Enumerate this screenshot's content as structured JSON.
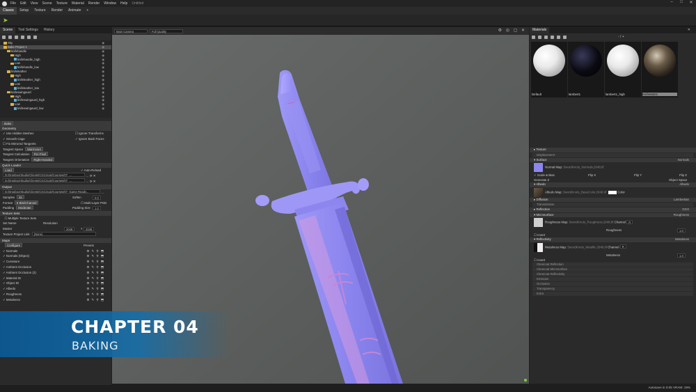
{
  "app": {
    "menu": [
      "File",
      "Edit",
      "View",
      "Scene",
      "Texture",
      "Material",
      "Render",
      "Window",
      "Help"
    ],
    "document_title": "Untitled"
  },
  "modes": [
    "Classic",
    "Setup",
    "Texture",
    "Render",
    "Animate",
    "+"
  ],
  "left_tabs": [
    "Scene",
    "Tool Settings",
    "History"
  ],
  "tree": [
    {
      "label": "Sky",
      "indent": 1,
      "type": "folder"
    },
    {
      "label": "Bake Project 1",
      "indent": 1,
      "type": "folder",
      "selected": true
    },
    {
      "label": "knifehandle",
      "indent": 2,
      "type": "folder"
    },
    {
      "label": "High",
      "indent": 3,
      "type": "folder"
    },
    {
      "label": "knifehandle_high",
      "indent": 4,
      "type": "mesh"
    },
    {
      "label": "Low",
      "indent": 3,
      "type": "folder"
    },
    {
      "label": "knifehandle_low",
      "indent": 4,
      "type": "mesh"
    },
    {
      "label": "knifeleather",
      "indent": 2,
      "type": "folder"
    },
    {
      "label": "High",
      "indent": 3,
      "type": "folder"
    },
    {
      "label": "knifeleather_high",
      "indent": 4,
      "type": "mesh"
    },
    {
      "label": "Low",
      "indent": 3,
      "type": "folder"
    },
    {
      "label": "knifeleather_low",
      "indent": 4,
      "type": "mesh"
    },
    {
      "label": "knifeswingaurd",
      "indent": 2,
      "type": "folder"
    },
    {
      "label": "High",
      "indent": 3,
      "type": "folder"
    },
    {
      "label": "knifeswingaurd_high",
      "indent": 4,
      "type": "mesh"
    },
    {
      "label": "Low",
      "indent": 3,
      "type": "folder"
    },
    {
      "label": "knifeswingaurd_low",
      "indent": 4,
      "type": "mesh"
    }
  ],
  "bake": {
    "button": "Bake",
    "geometry_header": "Geometry",
    "use_hidden": "Use Hidden Meshes",
    "ignore_transforms": "Ignore Transforms",
    "smooth_cage": "Smooth Cage",
    "ignore_back_faces": "Ignore Back Faces",
    "fix_mirrored": "Fix Mirrored Tangents",
    "tangent_space_label": "Tangent Space",
    "tangent_space": "Marmoset",
    "tangent_calc_label": "Tangent Calculation",
    "tangent_calc": "Per-Pixel",
    "tangent_orient_label": "Tangent Orientation",
    "tangent_orient": "Right-Handed",
    "quick_loader": "Quick Loader",
    "load": "Load",
    "auto_reload": "Auto-Reload",
    "path1": "D:/Dropbox/Studio/Clients/CGCircuit/Courses/07_...",
    "path2": "D:/Dropbox/Studio/Clients/CGCircuit/Courses/07_...",
    "output_header": "Output",
    "output_path": "D:/Dropbox/Studio/Clients/CGCircuit/Courses/07_Game Ready...",
    "samples_label": "Samples",
    "samples": "4x",
    "soften_label": "Soften",
    "soften": "0.0",
    "format_label": "Format",
    "format": "8 Bits/Channel",
    "multi_layer": "Multi-Layer PSD",
    "padding_label": "Padding",
    "padding": "Moderate",
    "padding_size_label": "Padding Size",
    "padding_size": "1.0",
    "texture_sets": "Texture Sets",
    "multiple_sets": "Multiple Texture Sets",
    "set_name": "Set Name",
    "resolution": "Resolution",
    "master": "Master",
    "res_w": "2048",
    "res_h": "2048",
    "project_link_label": "Texture Project Link",
    "project_link": "(None)",
    "maps_header": "Maps",
    "configure": "Configure",
    "presets": "Presets",
    "maps": [
      "Normals",
      "Normals (Object)",
      "Curvature",
      "Ambient Occlusion",
      "Ambient Occlusion (2)",
      "Material ID",
      "Object ID",
      "Albedo",
      "Roughness",
      "Metalness"
    ]
  },
  "viewport": {
    "camera": "Main Camera",
    "quality": "Full Quality"
  },
  "materials": {
    "title": "Materials",
    "count": "- / +",
    "items": [
      {
        "name": "Default",
        "style": "white"
      },
      {
        "name": "lambert1",
        "style": "dark"
      },
      {
        "name": "lambert1_high",
        "style": "white"
      },
      {
        "name": "KnifeMat01",
        "style": "metal",
        "selected": true
      }
    ],
    "sections": {
      "texture": "Texture",
      "displacement": "Displacement",
      "surface": "Surface",
      "surface_val": "Normals",
      "normal_map": "Normal Map:",
      "normal_file": "SwordKnots_Normals.2048.tif",
      "scale_bias": "Scale & Bias",
      "flip_x": "Flip X",
      "flip_y": "Flip Y",
      "flip_z": "Flip Z",
      "generate_z": "Generate Z",
      "object_space": "Object Space",
      "albedo": "Albedo",
      "albedo_val": "Albedo",
      "albedo_map": "Albedo Map:",
      "albedo_file": "SwordKnots_BaseColor.2048.tif",
      "color": "Color",
      "diffusion": "Diffusion",
      "diffusion_val": "Lambertian",
      "transmission": "Transmission",
      "reflection": "Reflection",
      "reflection_val": "GGX",
      "microsurface": "Microsurface",
      "microsurface_val": "Roughness",
      "roughness_map": "Roughness Map:",
      "roughness_file": "SwordKnots_Roughness.2048.tif",
      "channel": "Channel",
      "channel_val": "R",
      "roughness": "Roughness",
      "roughness_val": "1.0",
      "invert": "Invert",
      "reflectivity": "Reflectivity",
      "reflectivity_val": "Metalness",
      "metalness_map": "Metalness Map:",
      "metalness_file": "SwordKnots_Metallic.2048.tif",
      "metalness": "Metalness",
      "metalness_val": "1.0",
      "extra": [
        "Clearcoat Reflection",
        "Clearcoat Microsurface",
        "Clearcoat Reflectivity",
        "Emission",
        "Occlusion",
        "Transparency",
        "Extra"
      ]
    }
  },
  "status": "Autosave in 0:05   VRAM: 19%",
  "banner": {
    "title": "CHAPTER 04",
    "subtitle": "BAKING"
  },
  "colors": {
    "accent": "#9ad24a",
    "banner": "#14619a",
    "normal_map": "#8c86ee"
  }
}
